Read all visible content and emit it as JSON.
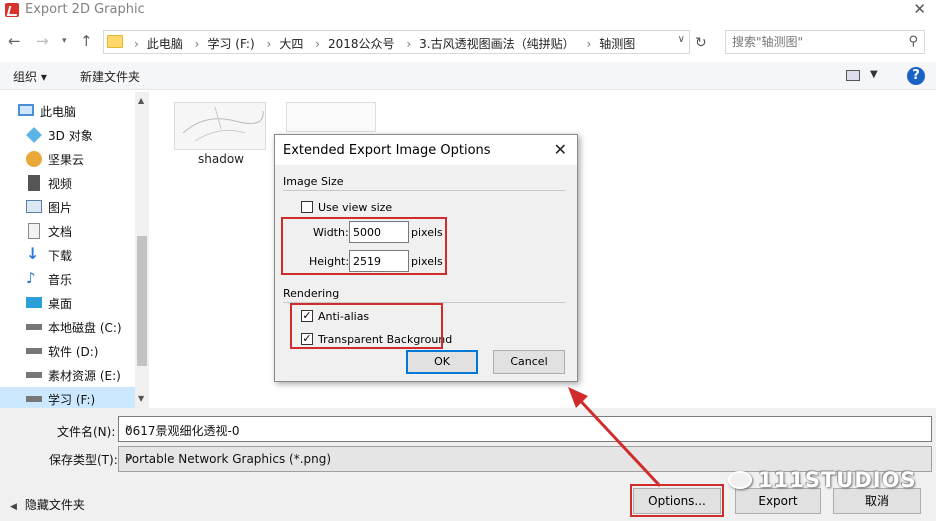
{
  "window": {
    "title": "Export 2D Graphic",
    "close_glyph": "✕"
  },
  "address_bar": {
    "breadcrumbs": [
      "此电脑",
      "学习 (F:)",
      "大四",
      "2018公众号",
      "3.古风透视图画法（纯拼贴）",
      "轴测图"
    ],
    "search_placeholder": "搜索\"轴测图\""
  },
  "toolbar": {
    "organize_label": "组织 ▾",
    "new_folder_label": "新建文件夹",
    "help_glyph": "?"
  },
  "sidebar": {
    "items": [
      {
        "label": "此电脑",
        "icon": "computer-icon",
        "color": "#4a8fd8"
      },
      {
        "label": "3D 对象",
        "icon": "3d-objects-icon",
        "color": "#5bb3e6"
      },
      {
        "label": "坚果云",
        "icon": "nutstore-icon",
        "color": "#e8a93a"
      },
      {
        "label": "视频",
        "icon": "video-icon",
        "color": "#555555"
      },
      {
        "label": "图片",
        "icon": "pictures-icon",
        "color": "#5a7fa8"
      },
      {
        "label": "文档",
        "icon": "documents-icon",
        "color": "#8a8a8a"
      },
      {
        "label": "下载",
        "icon": "download-icon",
        "color": "#2a7bd5"
      },
      {
        "label": "音乐",
        "icon": "music-icon",
        "color": "#2a7bd5"
      },
      {
        "label": "桌面",
        "icon": "desktop-icon",
        "color": "#2a9fd8"
      },
      {
        "label": "本地磁盘 (C:)",
        "icon": "drive-icon",
        "color": "#666666"
      },
      {
        "label": "软件 (D:)",
        "icon": "drive-icon",
        "color": "#666666"
      },
      {
        "label": "素材资源 (E:)",
        "icon": "drive-icon",
        "color": "#666666"
      },
      {
        "label": "学习 (F:)",
        "icon": "drive-icon",
        "color": "#666666",
        "selected": true
      }
    ]
  },
  "files": [
    {
      "name": "shadow"
    }
  ],
  "save_panel": {
    "filename_label": "文件名(N):",
    "filename_value": "0617景观细化透视-0",
    "filetype_label": "保存类型(T):",
    "filetype_value": "Portable Network Graphics (*.png)",
    "hide_folders_label": "隐藏文件夹",
    "options_button": "Options...",
    "export_button": "Export",
    "cancel_button": "取消"
  },
  "dialog": {
    "title": "Extended Export Image Options",
    "close_glyph": "✕",
    "image_size_group": "Image Size",
    "use_view_size_label": "Use view size",
    "use_view_size_checked": false,
    "width_label": "Width:",
    "width_value": "5000",
    "height_label": "Height:",
    "height_value": "2519",
    "unit_label": "pixels",
    "rendering_group": "Rendering",
    "anti_alias_label": "Anti-alias",
    "anti_alias_checked": true,
    "transparent_bg_label": "Transparent Background",
    "transparent_bg_checked": true,
    "ok_button": "OK",
    "cancel_button": "Cancel"
  },
  "watermark": "111STUDIOS",
  "colors": {
    "annotation_red": "#d12c2c",
    "selection_blue": "#cce8ff",
    "accent_blue": "#0078d7"
  }
}
